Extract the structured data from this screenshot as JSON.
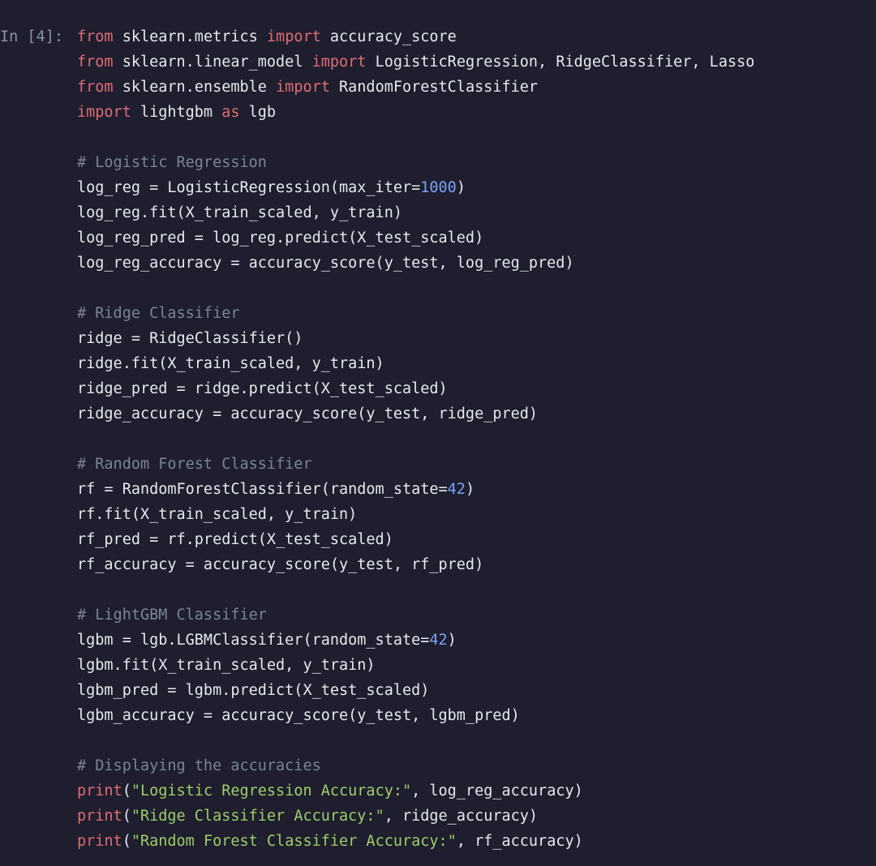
{
  "cell": {
    "prompt": "In [4]:",
    "lines": [
      [
        {
          "c": "t-kw",
          "t": "from"
        },
        {
          "c": "t-id",
          "t": " sklearn.metrics "
        },
        {
          "c": "t-kw",
          "t": "import"
        },
        {
          "c": "t-id",
          "t": " accuracy_score"
        }
      ],
      [
        {
          "c": "t-kw",
          "t": "from"
        },
        {
          "c": "t-id",
          "t": " sklearn.linear_model "
        },
        {
          "c": "t-kw",
          "t": "import"
        },
        {
          "c": "t-id",
          "t": " LogisticRegression, RidgeClassifier, Lasso"
        }
      ],
      [
        {
          "c": "t-kw",
          "t": "from"
        },
        {
          "c": "t-id",
          "t": " sklearn.ensemble "
        },
        {
          "c": "t-kw",
          "t": "import"
        },
        {
          "c": "t-id",
          "t": " RandomForestClassifier"
        }
      ],
      [
        {
          "c": "t-kw",
          "t": "import"
        },
        {
          "c": "t-id",
          "t": " lightgbm "
        },
        {
          "c": "t-as",
          "t": "as"
        },
        {
          "c": "t-id",
          "t": " lgb"
        }
      ],
      [
        {
          "c": "t-id",
          "t": ""
        }
      ],
      [
        {
          "c": "t-cmt",
          "t": "# Logistic Regression"
        }
      ],
      [
        {
          "c": "t-id",
          "t": "log_reg = LogisticRegression(max_iter="
        },
        {
          "c": "t-num",
          "t": "1000"
        },
        {
          "c": "t-id",
          "t": ")"
        }
      ],
      [
        {
          "c": "t-id",
          "t": "log_reg.fit(X_train_scaled, y_train)"
        }
      ],
      [
        {
          "c": "t-id",
          "t": "log_reg_pred = log_reg.predict(X_test_scaled)"
        }
      ],
      [
        {
          "c": "t-id",
          "t": "log_reg_accuracy = accuracy_score(y_test, log_reg_pred)"
        }
      ],
      [
        {
          "c": "t-id",
          "t": ""
        }
      ],
      [
        {
          "c": "t-cmt",
          "t": "# Ridge Classifier"
        }
      ],
      [
        {
          "c": "t-id",
          "t": "ridge = RidgeClassifier()"
        }
      ],
      [
        {
          "c": "t-id",
          "t": "ridge.fit(X_train_scaled, y_train)"
        }
      ],
      [
        {
          "c": "t-id",
          "t": "ridge_pred = ridge.predict(X_test_scaled)"
        }
      ],
      [
        {
          "c": "t-id",
          "t": "ridge_accuracy = accuracy_score(y_test, ridge_pred)"
        }
      ],
      [
        {
          "c": "t-id",
          "t": ""
        }
      ],
      [
        {
          "c": "t-cmt",
          "t": "# Random Forest Classifier"
        }
      ],
      [
        {
          "c": "t-id",
          "t": "rf = RandomForestClassifier(random_state="
        },
        {
          "c": "t-num",
          "t": "42"
        },
        {
          "c": "t-id",
          "t": ")"
        }
      ],
      [
        {
          "c": "t-id",
          "t": "rf.fit(X_train_scaled, y_train)"
        }
      ],
      [
        {
          "c": "t-id",
          "t": "rf_pred = rf.predict(X_test_scaled)"
        }
      ],
      [
        {
          "c": "t-id",
          "t": "rf_accuracy = accuracy_score(y_test, rf_pred)"
        }
      ],
      [
        {
          "c": "t-id",
          "t": ""
        }
      ],
      [
        {
          "c": "t-cmt",
          "t": "# LightGBM Classifier"
        }
      ],
      [
        {
          "c": "t-id",
          "t": "lgbm = lgb.LGBMClassifier(random_state="
        },
        {
          "c": "t-num",
          "t": "42"
        },
        {
          "c": "t-id",
          "t": ")"
        }
      ],
      [
        {
          "c": "t-id",
          "t": "lgbm.fit(X_train_scaled, y_train)"
        }
      ],
      [
        {
          "c": "t-id",
          "t": "lgbm_pred = lgbm.predict(X_test_scaled)"
        }
      ],
      [
        {
          "c": "t-id",
          "t": "lgbm_accuracy = accuracy_score(y_test, lgbm_pred)"
        }
      ],
      [
        {
          "c": "t-id",
          "t": ""
        }
      ],
      [
        {
          "c": "t-cmt",
          "t": "# Displaying the accuracies"
        }
      ],
      [
        {
          "c": "t-kw",
          "t": "print"
        },
        {
          "c": "t-id",
          "t": "("
        },
        {
          "c": "t-str",
          "t": "\"Logistic Regression Accuracy:\""
        },
        {
          "c": "t-id",
          "t": ", log_reg_accuracy)"
        }
      ],
      [
        {
          "c": "t-kw",
          "t": "print"
        },
        {
          "c": "t-id",
          "t": "("
        },
        {
          "c": "t-str",
          "t": "\"Ridge Classifier Accuracy:\""
        },
        {
          "c": "t-id",
          "t": ", ridge_accuracy)"
        }
      ],
      [
        {
          "c": "t-kw",
          "t": "print"
        },
        {
          "c": "t-id",
          "t": "("
        },
        {
          "c": "t-str",
          "t": "\"Random Forest Classifier Accuracy:\""
        },
        {
          "c": "t-id",
          "t": ", rf_accuracy)"
        }
      ]
    ]
  }
}
